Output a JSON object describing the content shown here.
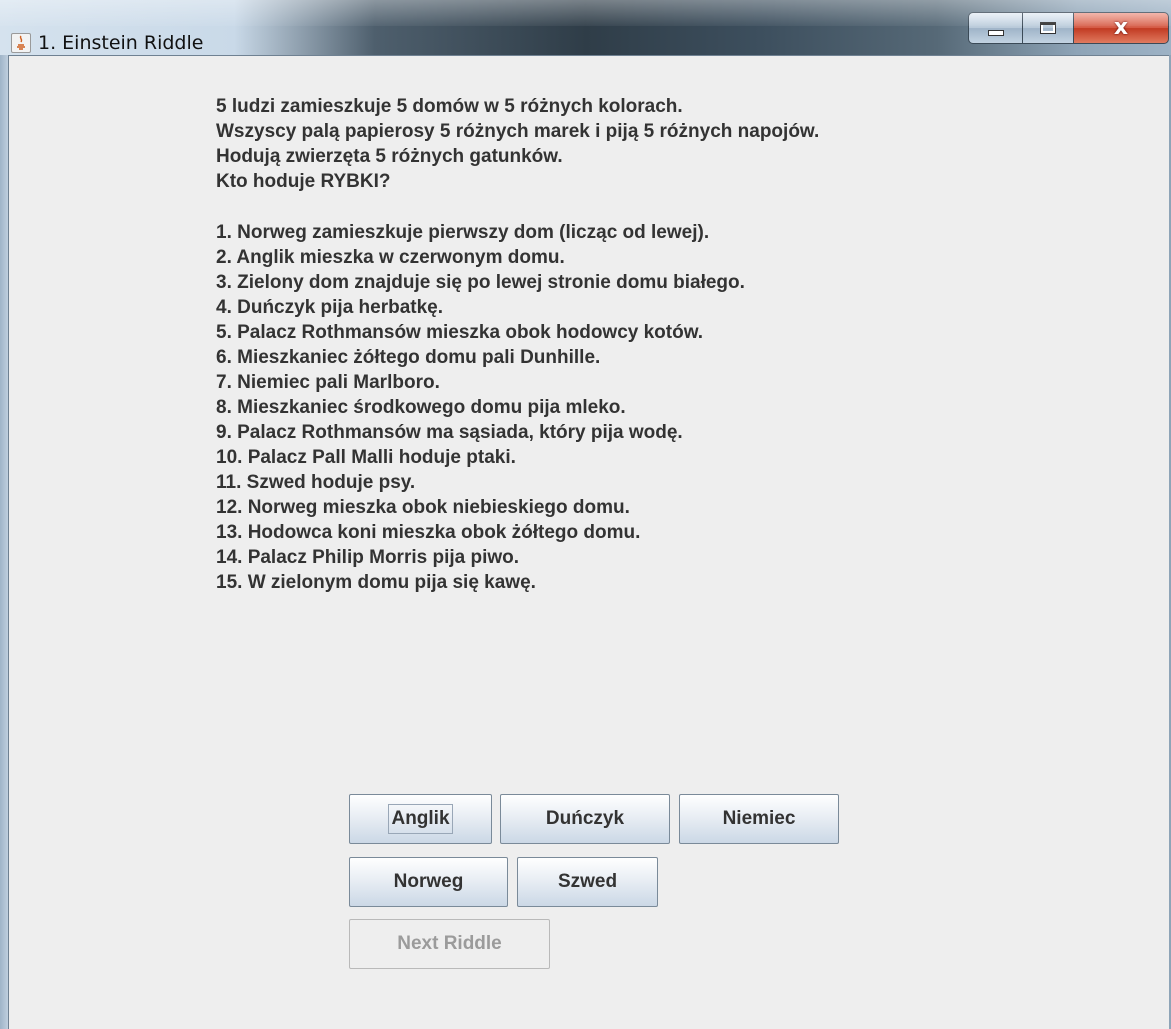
{
  "window": {
    "title": "1. Einstein Riddle",
    "controls": {
      "minimize_icon": "minimize-icon",
      "maximize_icon": "maximize-icon",
      "close_icon": "close-icon",
      "close_glyph": "x"
    }
  },
  "riddle": {
    "intro": [
      "5 ludzi zamieszkuje 5 domów w 5 różnych kolorach.",
      "Wszyscy palą papierosy 5 różnych marek i piją 5 różnych napojów.",
      "Hodują zwierzęta 5 różnych gatunków.",
      "Kto hoduje RYBKI?"
    ],
    "clues": [
      "1. Norweg zamieszkuje pierwszy dom (licząc od lewej).",
      "2. Anglik mieszka w czerwonym domu.",
      "3. Zielony dom znajduje się po lewej stronie domu białego.",
      "4. Duńczyk pija herbatkę.",
      "5. Palacz Rothmansów mieszka obok hodowcy kotów.",
      "6. Mieszkaniec żółtego domu pali Dunhille.",
      "7. Niemiec pali Marlboro.",
      "8. Mieszkaniec środkowego domu pija mleko.",
      "9. Palacz Rothmansów ma sąsiada, który pija wodę.",
      "10. Palacz Pall Malli hoduje ptaki.",
      "11. Szwed hoduje psy.",
      "12. Norweg mieszka obok niebieskiego domu.",
      "13. Hodowca koni mieszka obok żółtego domu.",
      "14. Palacz Philip Morris pija piwo.",
      "15. W zielonym domu pija się kawę."
    ]
  },
  "answers": {
    "row1": [
      "Anglik",
      "Duńczyk",
      "Niemiec"
    ],
    "row2": [
      "Norweg",
      "Szwed"
    ],
    "next": "Next Riddle"
  }
}
